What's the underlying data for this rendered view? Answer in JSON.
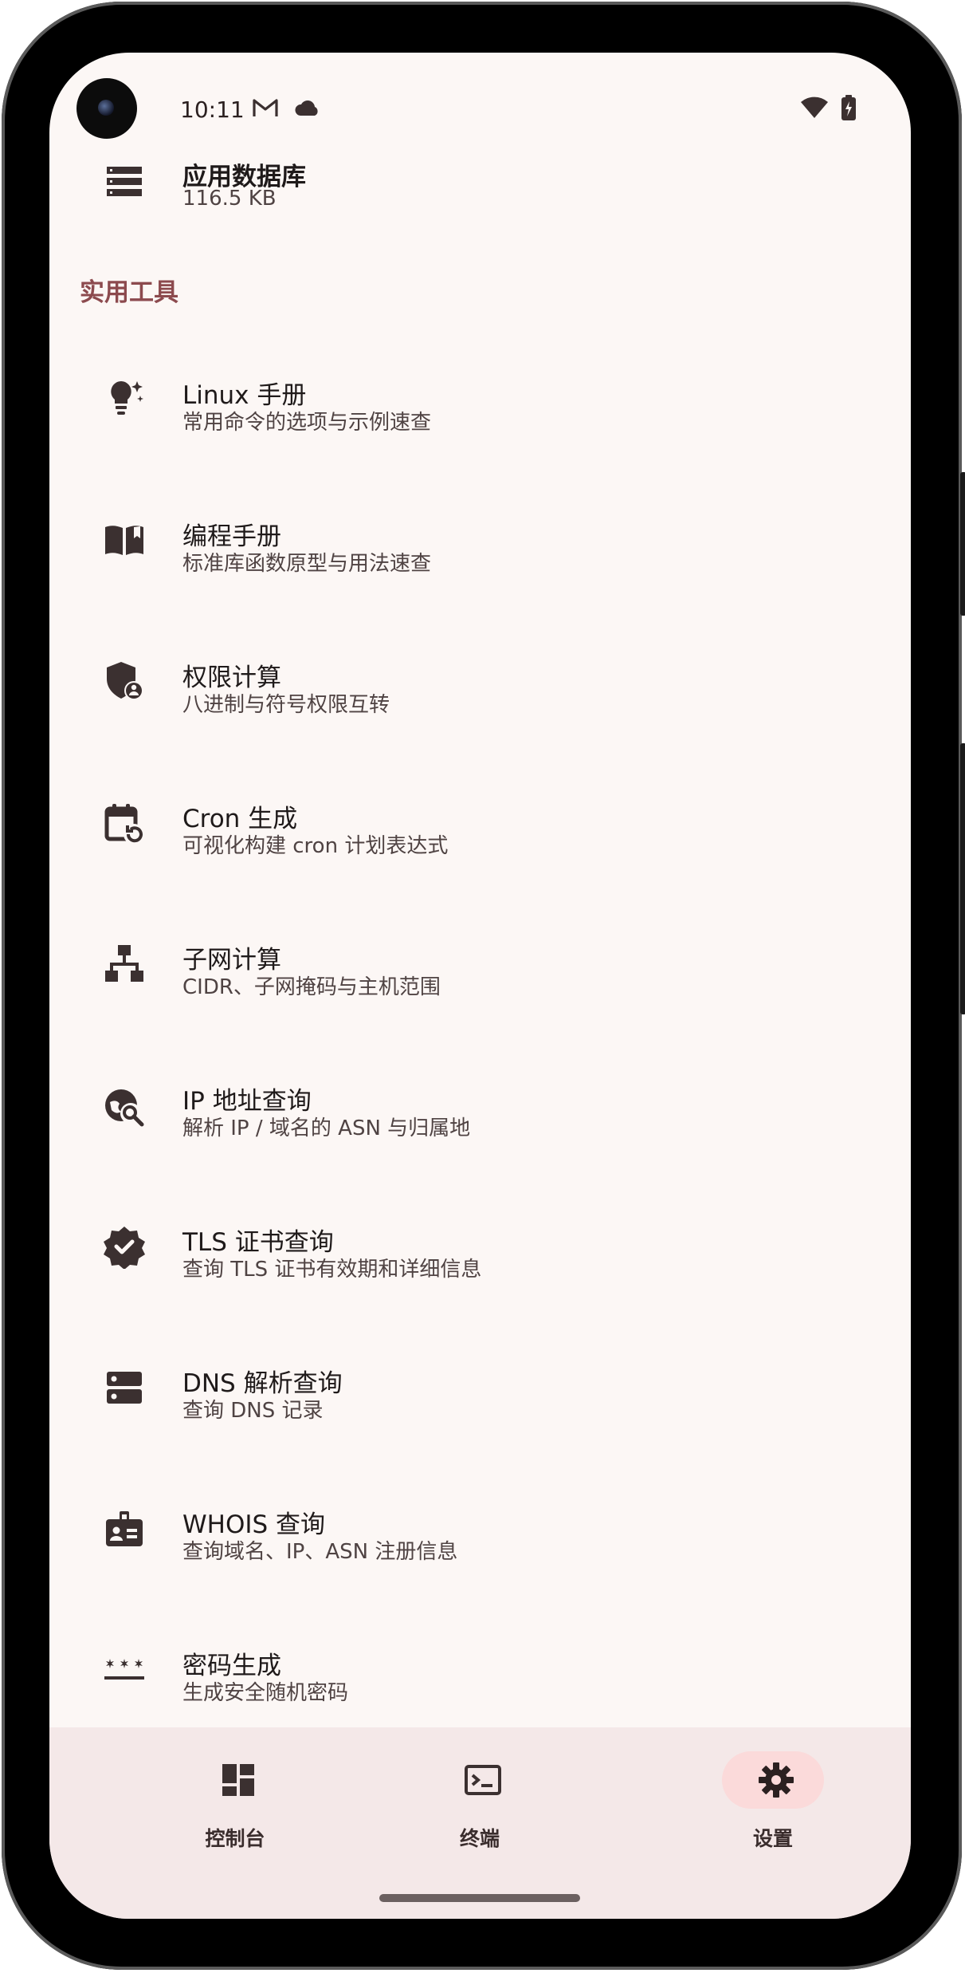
{
  "status_bar": {
    "time": "10:11",
    "icons": [
      "gmail-icon",
      "cloud-icon",
      "wifi-icon",
      "battery-charging-icon"
    ]
  },
  "storage_item": {
    "title": "应用数据库",
    "size": "116.5 KB",
    "icon": "storage-icon"
  },
  "section": {
    "title": "实用工具"
  },
  "tools": [
    {
      "title": "Linux 手册",
      "subtitle": "常用命令的选项与示例速查",
      "icon": "lightbulb-sparkle-icon"
    },
    {
      "title": "编程手册",
      "subtitle": "标准库函数原型与用法速查",
      "icon": "book-open-icon"
    },
    {
      "title": "权限计算",
      "subtitle": "八进制与符号权限互转",
      "icon": "shield-person-icon"
    },
    {
      "title": "Cron 生成",
      "subtitle": "可视化构建 cron 计划表达式",
      "icon": "calendar-refresh-icon"
    },
    {
      "title": "子网计算",
      "subtitle": "CIDR、子网掩码与主机范围",
      "icon": "network-tree-icon"
    },
    {
      "title": "IP 地址查询",
      "subtitle": "解析 IP / 域名的 ASN 与归属地",
      "icon": "globe-search-icon"
    },
    {
      "title": "TLS 证书查询",
      "subtitle": "查询 TLS 证书有效期和详细信息",
      "icon": "verified-badge-icon"
    },
    {
      "title": "DNS 解析查询",
      "subtitle": "查询 DNS 记录",
      "icon": "dns-server-icon"
    },
    {
      "title": "WHOIS 查询",
      "subtitle": "查询域名、IP、ASN 注册信息",
      "icon": "id-badge-icon"
    },
    {
      "title": "密码生成",
      "subtitle": "生成安全随机密码",
      "icon": "password-icon"
    }
  ],
  "nav": [
    {
      "label": "控制台",
      "icon": "dashboard-icon",
      "active": false
    },
    {
      "label": "终端",
      "icon": "terminal-icon",
      "active": false
    },
    {
      "label": "设置",
      "icon": "settings-icon",
      "active": true
    }
  ],
  "colors": {
    "background": "#fcf7f5",
    "section_accent": "#8c4a4e",
    "nav_background": "#f4e8e8",
    "nav_active_pill": "#fbdada",
    "text_primary": "#1f1a1a",
    "text_secondary": "#4f4343"
  }
}
